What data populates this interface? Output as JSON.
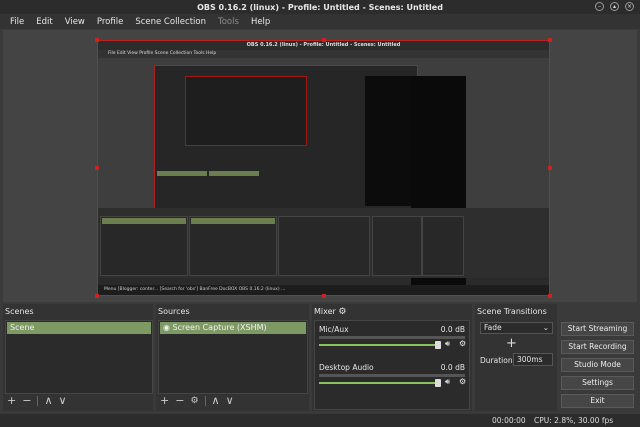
{
  "window": {
    "title": "OBS 0.16.2 (linux) - Profile: Untitled - Scenes: Untitled"
  },
  "menu": {
    "items": [
      "File",
      "Edit",
      "View",
      "Profile",
      "Scene Collection",
      "Tools",
      "Help"
    ]
  },
  "nested": {
    "title": "OBS 0.16.2 (linux) - Profile: Untitled - Scenes: Untitled",
    "menu": "File  Edit  View  Profile  Scene Collection  Tools  Help",
    "taskbar": "Menu   [Blogger: conter...   [Search for 'obs']   BanFree DocBOX   OBS 0.16.2 (linux) ..."
  },
  "scenes": {
    "title": "Scenes",
    "items": [
      "Scene"
    ],
    "add": "+",
    "remove": "−",
    "up": "∧",
    "down": "∨"
  },
  "sources": {
    "title": "Sources",
    "items": [
      "Screen Capture (XSHM)"
    ],
    "add": "+",
    "remove": "−",
    "up": "∧",
    "down": "∨"
  },
  "mixer": {
    "title": "Mixer",
    "tracks": [
      {
        "name": "Mic/Aux",
        "db": "0.0 dB",
        "level": 0.0
      },
      {
        "name": "Desktop Audio",
        "db": "0.0 dB",
        "level": 0.0
      }
    ]
  },
  "transitions": {
    "title": "Scene Transitions",
    "selected": "Fade",
    "add": "+",
    "duration_label": "Duration",
    "duration_value": "300ms"
  },
  "controls": {
    "start_streaming": "Start Streaming",
    "start_recording": "Start Recording",
    "studio_mode": "Studio Mode",
    "settings": "Settings",
    "exit": "Exit"
  },
  "status": {
    "time": "00:00:00",
    "cpu": "CPU: 2.8%, 30.00 fps"
  },
  "colors": {
    "accent": "#7e9a64",
    "preview_border": "#c02020"
  }
}
